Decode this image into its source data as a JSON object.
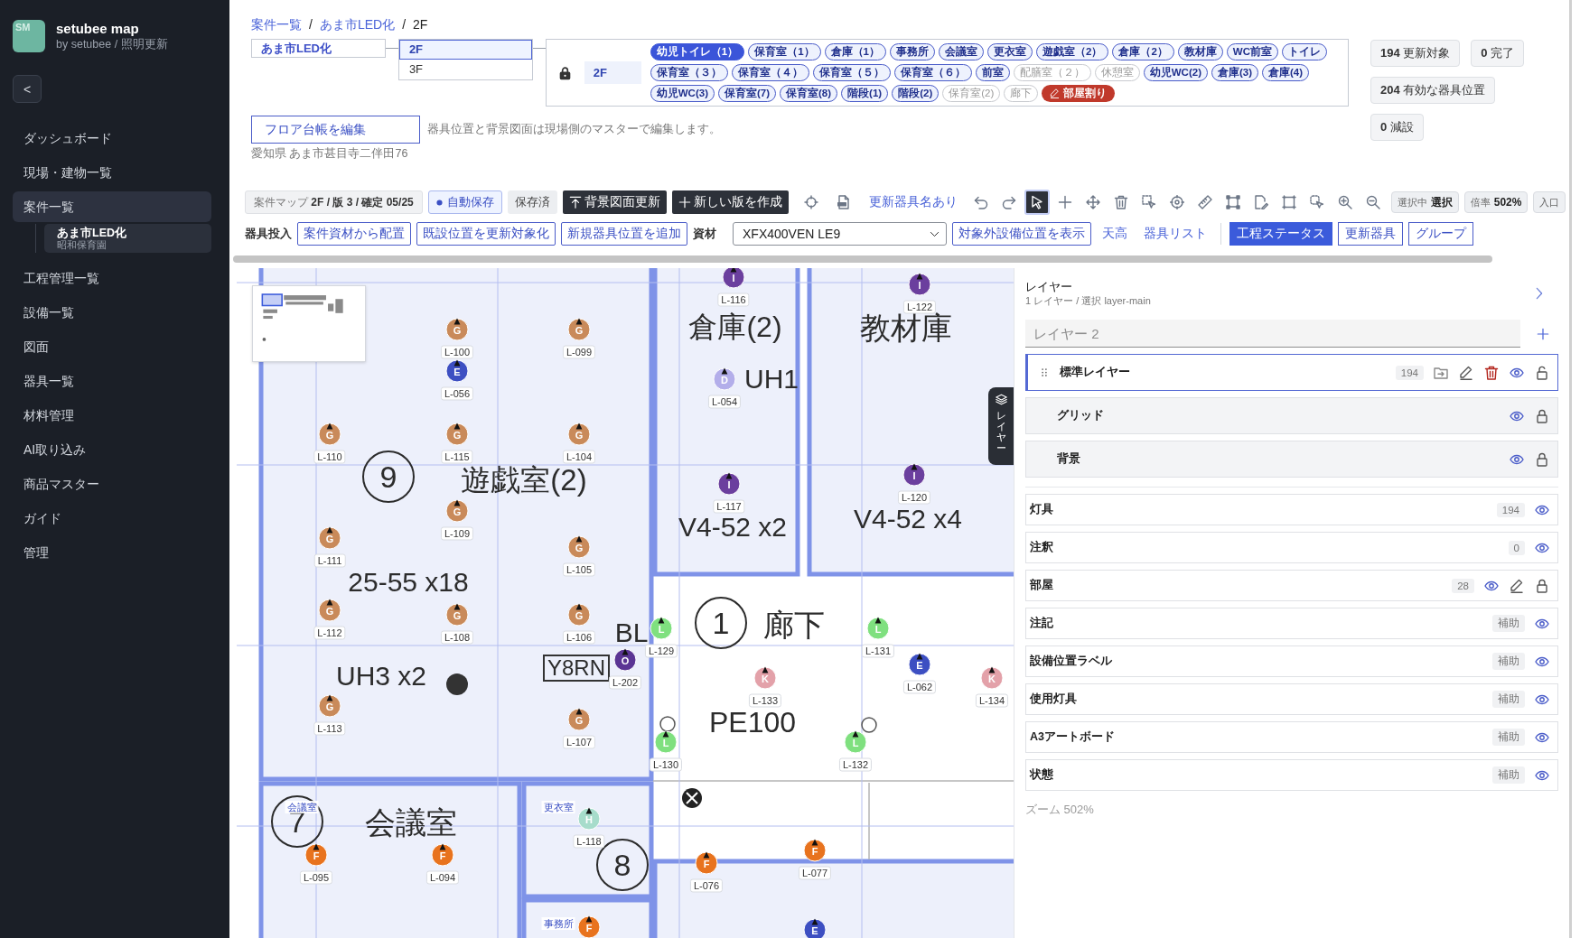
{
  "sidebar": {
    "logo": "SM",
    "app_name": "setubee map",
    "app_subtitle": "by setubee / 照明更新",
    "collapse_button": "<",
    "nav": [
      {
        "label": "ダッシュボード",
        "selected": false
      },
      {
        "label": "現場・建物一覧",
        "selected": false
      },
      {
        "label": "案件一覧",
        "selected": true,
        "children": [
          {
            "title": "あま市LED化",
            "subtitle": "昭和保育園",
            "selected": true
          }
        ]
      },
      {
        "label": "工程管理一覧",
        "selected": false
      },
      {
        "label": "設備一覧",
        "selected": false
      },
      {
        "label": "図面",
        "selected": false
      },
      {
        "label": "器具一覧",
        "selected": false
      },
      {
        "label": "材料管理",
        "selected": false
      },
      {
        "label": "AI取り込み",
        "selected": false
      },
      {
        "label": "商品マスター",
        "selected": false
      },
      {
        "label": "ガイド",
        "selected": false
      },
      {
        "label": "管理",
        "selected": false
      }
    ]
  },
  "breadcrumb": {
    "separator": "/",
    "items": [
      {
        "label": "案件一覧",
        "kind": "link"
      },
      {
        "label": "あま市LED化",
        "kind": "link"
      },
      {
        "label": "2F",
        "kind": "current"
      }
    ]
  },
  "floor_editor": {
    "project": "あま市LED化",
    "floors": [
      {
        "label": "2F",
        "selected": true
      },
      {
        "label": "3F",
        "selected": false
      }
    ],
    "locked": true,
    "floor_tag": "2F",
    "room_rows": [
      [
        {
          "label": "幼児トイレ（1）",
          "selected": true,
          "disabled": false
        },
        {
          "label": "保育室（1）",
          "selected": false,
          "disabled": false
        },
        {
          "label": "倉庫（1）",
          "selected": false,
          "disabled": false
        },
        {
          "label": "事務所",
          "selected": false,
          "disabled": false
        },
        {
          "label": "会議室",
          "selected": false,
          "disabled": false
        },
        {
          "label": "更衣室",
          "selected": false,
          "disabled": false
        },
        {
          "label": "遊戯室（2）",
          "selected": false,
          "disabled": false
        },
        {
          "label": "倉庫（2）",
          "selected": false,
          "disabled": false
        },
        {
          "label": "教材庫",
          "selected": false,
          "disabled": false
        },
        {
          "label": "WC前室",
          "selected": false,
          "disabled": false
        },
        {
          "label": "トイレ",
          "selected": false,
          "disabled": false
        }
      ],
      [
        {
          "label": "保育室（３）",
          "selected": false,
          "disabled": false
        },
        {
          "label": "保育室（４）",
          "selected": false,
          "disabled": false
        },
        {
          "label": "保育室（５）",
          "selected": false,
          "disabled": false
        },
        {
          "label": "保育室（６）",
          "selected": false,
          "disabled": false
        },
        {
          "label": "前室",
          "selected": false,
          "disabled": false
        },
        {
          "label": "配膳室（２）",
          "selected": false,
          "disabled": true
        },
        {
          "label": "休憩室",
          "selected": false,
          "disabled": true
        },
        {
          "label": "幼児WC(2)",
          "selected": false,
          "disabled": false
        },
        {
          "label": "倉庫(3)",
          "selected": false,
          "disabled": false
        },
        {
          "label": "倉庫(4)",
          "selected": false,
          "disabled": false
        }
      ],
      [
        {
          "label": "幼児WC(3)",
          "selected": false,
          "disabled": false
        },
        {
          "label": "保育室(7)",
          "selected": false,
          "disabled": false
        },
        {
          "label": "保育室(8)",
          "selected": false,
          "disabled": false
        },
        {
          "label": "階段(1)",
          "selected": false,
          "disabled": false
        },
        {
          "label": "階段(2)",
          "selected": false,
          "disabled": false
        },
        {
          "label": "保育室(2)",
          "selected": false,
          "disabled": true
        },
        {
          "label": "廊下",
          "selected": false,
          "disabled": true
        }
      ]
    ],
    "room_split_button": "部屋割り"
  },
  "stats": [
    {
      "value": "194",
      "label": "更新対象"
    },
    {
      "value": "0",
      "label": "完了"
    },
    {
      "value": "204",
      "label": "有効な器具位置"
    },
    {
      "value": "0",
      "label": "減設"
    }
  ],
  "edit_floor_button": "フロア台帳を編集",
  "note": "器具位置と背景図面は現場側のマスターで編集します。",
  "address": "愛知県 あま市甚目寺二伴田76",
  "toolbar": {
    "map_label": "案件マップ",
    "map_value": "2F / 版 3 / 確定 05/25",
    "autosave": {
      "label": "自動保存",
      "on": true
    },
    "save_status": "保存済",
    "actions": [
      {
        "label": "背景図面更新",
        "kind": "upload"
      },
      {
        "label": "新しい版を作成",
        "kind": "add"
      }
    ],
    "tools": [
      {
        "kind": "crosshair",
        "selected": false
      },
      {
        "kind": "pdf",
        "selected": false
      },
      {
        "kind": "link",
        "label": "更新器具名あり",
        "selected": false
      },
      {
        "kind": "undo",
        "selected": false
      },
      {
        "kind": "redo",
        "selected": false
      },
      {
        "kind": "pointer",
        "selected": true
      },
      {
        "kind": "add",
        "selected": false
      },
      {
        "kind": "move",
        "selected": false
      },
      {
        "kind": "trash",
        "selected": false
      },
      {
        "kind": "marquee",
        "selected": false
      },
      {
        "kind": "target",
        "selected": false
      },
      {
        "kind": "ruler",
        "selected": false
      },
      {
        "kind": "frame",
        "selected": false
      },
      {
        "kind": "edit",
        "selected": false
      },
      {
        "kind": "square",
        "selected": false
      },
      {
        "kind": "lasso",
        "selected": false
      },
      {
        "kind": "zoom_in",
        "selected": false
      },
      {
        "kind": "zoom_out",
        "selected": false
      }
    ],
    "indicators": [
      {
        "label": "選択中",
        "value": "選択"
      },
      {
        "label": "倍率",
        "value": "502%"
      },
      {
        "label": "入口"
      }
    ]
  },
  "fixture_bar": {
    "label": "器具投入",
    "buttons": [
      "案件資材から配置",
      "既設位置を更新対象化",
      "新規器具位置を追加"
    ],
    "material_label": "資材",
    "material_value": "XFX400VEN LE9",
    "show_button": "対象外設備位置を表示",
    "links": [
      "天高",
      "器具リスト"
    ],
    "views": [
      {
        "label": "工程ステータス",
        "selected": true
      },
      {
        "label": "更新器具",
        "selected": false
      },
      {
        "label": "グループ",
        "selected": false
      }
    ]
  },
  "map": {
    "layers_tab": "レイヤー",
    "plan_labels": [
      {
        "text": "倉庫(2)",
        "kind": "text"
      },
      {
        "text": "教材庫",
        "kind": "text"
      },
      {
        "text": "UH1",
        "kind": "text"
      },
      {
        "text": "遊戯室(2)",
        "kind": "text"
      },
      {
        "text": "V4-52 x2",
        "kind": "text"
      },
      {
        "text": "V4-52 x4",
        "kind": "text"
      },
      {
        "text": "25-55 x18",
        "kind": "text"
      },
      {
        "text": "UH3 x2",
        "kind": "text"
      },
      {
        "text": "BL",
        "kind": "text"
      },
      {
        "text": "Y8RN",
        "kind": "boxed"
      },
      {
        "text": "廊下",
        "kind": "text"
      },
      {
        "text": "PE100",
        "kind": "text"
      },
      {
        "text": "会議室",
        "kind": "text"
      },
      {
        "text": "9",
        "kind": "number"
      },
      {
        "text": "1",
        "kind": "number"
      },
      {
        "text": "7",
        "kind": "number"
      },
      {
        "text": "8",
        "kind": "number"
      }
    ],
    "room_tags": [
      "会議室",
      "更衣室",
      "事務所"
    ],
    "markers": [
      {
        "letter": "I",
        "label": "L-116",
        "color": "#6b3f9e"
      },
      {
        "letter": "I",
        "label": "L-122",
        "color": "#6b3f9e"
      },
      {
        "letter": "G",
        "label": "L-100",
        "color": "#c98a5a"
      },
      {
        "letter": "G",
        "label": "L-099",
        "color": "#c98a5a"
      },
      {
        "letter": "E",
        "label": "L-056",
        "color": "#3d4fc2"
      },
      {
        "letter": "D",
        "label": "L-054",
        "color": "#b3aeea"
      },
      {
        "letter": "G",
        "label": "L-110",
        "color": "#c98a5a"
      },
      {
        "letter": "G",
        "label": "L-115",
        "color": "#c98a5a"
      },
      {
        "letter": "G",
        "label": "L-104",
        "color": "#c98a5a"
      },
      {
        "letter": "I",
        "label": "L-117",
        "color": "#6b3f9e"
      },
      {
        "letter": "I",
        "label": "L-120",
        "color": "#6b3f9e"
      },
      {
        "letter": "G",
        "label": "L-109",
        "color": "#c98a5a"
      },
      {
        "letter": "G",
        "label": "L-111",
        "color": "#c98a5a"
      },
      {
        "letter": "G",
        "label": "L-105",
        "color": "#c98a5a"
      },
      {
        "letter": "G",
        "label": "L-112",
        "color": "#c98a5a"
      },
      {
        "letter": "G",
        "label": "L-108",
        "color": "#c98a5a"
      },
      {
        "letter": "G",
        "label": "L-106",
        "color": "#c98a5a"
      },
      {
        "letter": "L",
        "label": "L-129",
        "color": "#7fe07f"
      },
      {
        "letter": "L",
        "label": "L-131",
        "color": "#7fe07f"
      },
      {
        "letter": "O",
        "label": "L-202",
        "color": "#5b3594"
      },
      {
        "letter": "E",
        "label": "L-062",
        "color": "#3d4fc2"
      },
      {
        "letter": "K",
        "label": "L-133",
        "color": "#e3a1a9"
      },
      {
        "letter": "K",
        "label": "L-134",
        "color": "#e3a1a9"
      },
      {
        "letter": "G",
        "label": "L-113",
        "color": "#c98a5a"
      },
      {
        "letter": "G",
        "label": "L-107",
        "color": "#c98a5a"
      },
      {
        "letter": "L",
        "label": "L-130",
        "color": "#7fe07f"
      },
      {
        "letter": "L",
        "label": "L-132",
        "color": "#7fe07f"
      },
      {
        "letter": "F",
        "label": "L-095",
        "color": "#e8731e"
      },
      {
        "letter": "F",
        "label": "L-094",
        "color": "#e8731e"
      },
      {
        "letter": "H",
        "label": "L-118",
        "color": "#a7dccb"
      },
      {
        "letter": "F",
        "label": "L-076",
        "color": "#e8731e"
      },
      {
        "letter": "F",
        "label": "L-077",
        "color": "#e8731e"
      },
      {
        "letter": "F",
        "color": "#e8731e"
      },
      {
        "letter": "E",
        "color": "#3d4fc2"
      }
    ]
  },
  "layer_panel": {
    "title": "レイヤー",
    "subtitle": "1 レイヤー / 選択 layer-main",
    "new_layer_placeholder": "レイヤー 2",
    "layers": [
      {
        "name": "標準レイヤー",
        "kind": "user",
        "badge": "194",
        "selected": true,
        "visible": true,
        "locked": false
      },
      {
        "name": "グリッド",
        "kind": "base",
        "selected": false,
        "visible": true,
        "locked": true
      },
      {
        "name": "背景",
        "kind": "base",
        "selected": false,
        "visible": true,
        "locked": true
      }
    ],
    "system_layers": [
      {
        "name": "灯具",
        "badge": "194",
        "visible": true,
        "editable": false
      },
      {
        "name": "注釈",
        "badge": "0",
        "visible": true,
        "editable": false
      },
      {
        "name": "部屋",
        "badge": "28",
        "visible": true,
        "editable": true,
        "locked": true
      },
      {
        "name": "注記",
        "badge": "補助",
        "visible": true,
        "editable": false
      },
      {
        "name": "設備位置ラベル",
        "badge": "補助",
        "visible": true,
        "editable": false
      },
      {
        "name": "使用灯具",
        "badge": "補助",
        "visible": true,
        "editable": false
      },
      {
        "name": "A3アートボード",
        "badge": "補助",
        "visible": true,
        "editable": false
      },
      {
        "name": "状態",
        "badge": "補助",
        "visible": true,
        "editable": false
      }
    ],
    "zoom": "ズーム 502%"
  }
}
